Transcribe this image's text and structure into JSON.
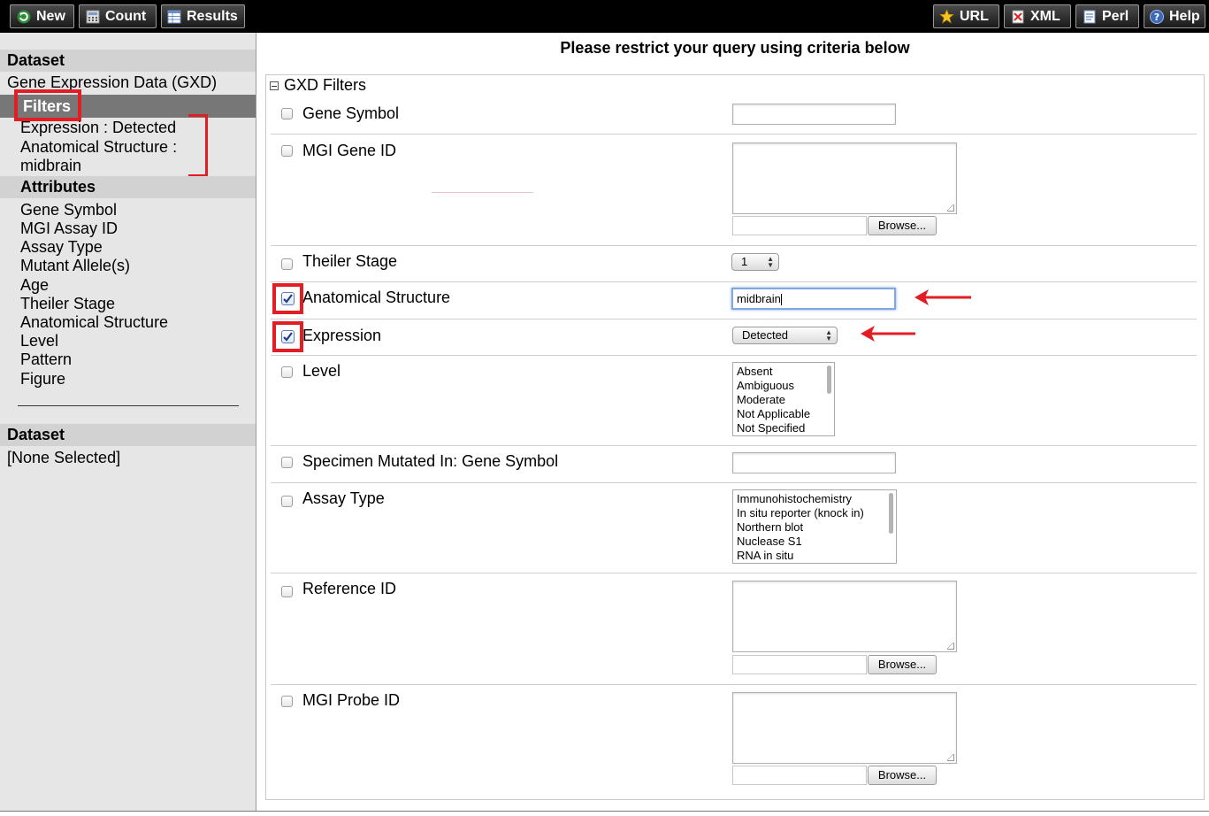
{
  "toolbar": {
    "new_label": "New",
    "count_label": "Count",
    "results_label": "Results",
    "url_label": "URL",
    "xml_label": "XML",
    "perl_label": "Perl",
    "help_label": "Help"
  },
  "sidebar": {
    "dataset_heading": "Dataset",
    "dataset_name": "Gene Expression Data (GXD)",
    "filters_heading": "Filters",
    "filters": [
      "Expression : Detected",
      "Anatomical Structure :",
      "midbrain"
    ],
    "attributes_heading": "Attributes",
    "attributes": [
      "Gene Symbol",
      "MGI Assay ID",
      "Assay Type",
      "Mutant Allele(s)",
      "Age",
      "Theiler Stage",
      "Anatomical Structure",
      "Level",
      "Pattern",
      "Figure"
    ],
    "dataset2_heading": "Dataset",
    "dataset2_value": "[None Selected]"
  },
  "main": {
    "title": "Please restrict your query using criteria below",
    "panel_heading": "GXD Filters",
    "browse_label": "Browse...",
    "filters": {
      "gene_symbol": "Gene Symbol",
      "mgi_gene_id": "MGI Gene ID",
      "theiler_stage": "Theiler Stage",
      "theiler_stage_value": "1",
      "anatomical_structure": "Anatomical Structure",
      "anatomical_structure_value": "midbrain",
      "expression": "Expression",
      "expression_value": "Detected",
      "level": "Level",
      "level_options": [
        "Absent",
        "Ambiguous",
        "Moderate",
        "Not Applicable",
        "Not Specified"
      ],
      "specimen_mutated": "Specimen Mutated In: Gene Symbol",
      "assay_type": "Assay Type",
      "assay_type_options": [
        "Immunohistochemistry",
        "In situ reporter (knock in)",
        "Northern blot",
        "Nuclease S1",
        "RNA in situ"
      ],
      "reference_id": "Reference ID",
      "mgi_probe_id": "MGI Probe ID"
    }
  },
  "colors": {
    "highlight": "#e21d24",
    "toolbar_bg": "#000000",
    "sidebar_bg": "#e6e6e6"
  }
}
